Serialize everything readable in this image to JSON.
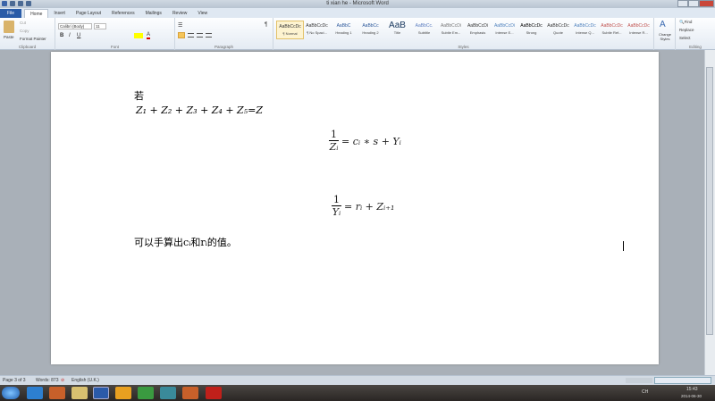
{
  "window": {
    "title": "ti xian he - Microsoft Word"
  },
  "tabs": [
    "File",
    "Home",
    "Insert",
    "Page Layout",
    "References",
    "Mailings",
    "Review",
    "View"
  ],
  "ribbon": {
    "clipboard": {
      "label": "Clipboard",
      "paste": "Paste",
      "cut": "Cut",
      "copy": "Copy",
      "format_painter": "Format Painter"
    },
    "font": {
      "label": "Font",
      "font_name": "Calibri (Body)",
      "font_size": "11"
    },
    "paragraph": {
      "label": "Paragraph"
    },
    "styles": {
      "label": "Styles",
      "items": [
        {
          "preview": "AaBbCcDc",
          "name": "¶ Normal"
        },
        {
          "preview": "AaBbCcDc",
          "name": "¶ No Spaci..."
        },
        {
          "preview": "AaBbC",
          "name": "Heading 1"
        },
        {
          "preview": "AaBbCc",
          "name": "Heading 2"
        },
        {
          "preview": "AaB",
          "name": "Title"
        },
        {
          "preview": "AaBbCc.",
          "name": "Subtitle"
        },
        {
          "preview": "AaBbCcDi",
          "name": "Subtle Em..."
        },
        {
          "preview": "AaBbCcDi",
          "name": "Emphasis"
        },
        {
          "preview": "AaBbCcDi",
          "name": "Intense E..."
        },
        {
          "preview": "AaBbCcDc",
          "name": "Strong"
        },
        {
          "preview": "AaBbCcDc",
          "name": "Quote"
        },
        {
          "preview": "AaBbCcDc",
          "name": "Intense Q..."
        },
        {
          "preview": "AaBbCcDc",
          "name": "Subtle Ref..."
        },
        {
          "preview": "AaBbCcDc",
          "name": "Intense R..."
        }
      ],
      "change_styles": "Change Styles"
    },
    "editing": {
      "label": "Editing",
      "find": "Find",
      "replace": "Replace",
      "select": "Select"
    }
  },
  "document": {
    "line1": "若",
    "line2": "Z₁ + Z₂ + Z₃ + Z₄ + Z₅=Z",
    "eq1": {
      "num": "1",
      "den": "Zᵢ",
      "rhs": "= cᵢ ∗ s + Yᵢ"
    },
    "eq2": {
      "num": "1",
      "den": "Yᵢ",
      "rhs": "= rᵢ + Zᵢ₊₁"
    },
    "line3": "可以手算出cᵢ和rᵢ的值。"
  },
  "status": {
    "page": "Page 3 of 3",
    "words": "Words: 873",
    "language": "English (U.K.)"
  },
  "taskbar": {
    "ime": "CH",
    "time": "15:43",
    "date": "2014-06-30"
  }
}
